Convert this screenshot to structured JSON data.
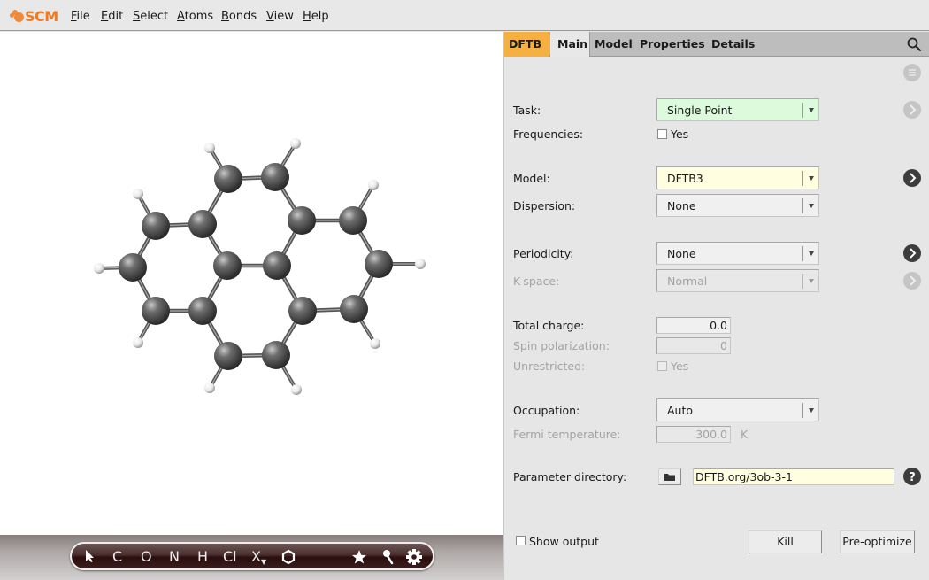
{
  "app": {
    "logo_text": "SCM",
    "brand_color": "#ee7a24"
  },
  "menubar": {
    "items": [
      {
        "label": "File",
        "accel": "F"
      },
      {
        "label": "Edit",
        "accel": "E"
      },
      {
        "label": "Select",
        "accel": "S"
      },
      {
        "label": "Atoms",
        "accel": "A"
      },
      {
        "label": "Bonds",
        "accel": "B"
      },
      {
        "label": "View",
        "accel": "V"
      },
      {
        "label": "Help",
        "accel": "H"
      }
    ]
  },
  "viewer": {
    "molecule": "pyrene",
    "atoms": [
      {
        "el": "C"
      },
      {
        "el": "C"
      },
      {
        "el": "C"
      },
      {
        "el": "C"
      },
      {
        "el": "C"
      },
      {
        "el": "C"
      },
      {
        "el": "C"
      },
      {
        "el": "C"
      },
      {
        "el": "C"
      },
      {
        "el": "C"
      },
      {
        "el": "C"
      },
      {
        "el": "C"
      },
      {
        "el": "C"
      },
      {
        "el": "C"
      },
      {
        "el": "C"
      },
      {
        "el": "C"
      },
      {
        "el": "H"
      },
      {
        "el": "H"
      },
      {
        "el": "H"
      },
      {
        "el": "H"
      },
      {
        "el": "H"
      },
      {
        "el": "H"
      },
      {
        "el": "H"
      },
      {
        "el": "H"
      },
      {
        "el": "H"
      },
      {
        "el": "H"
      }
    ],
    "toolbar": {
      "tools": [
        {
          "name": "select-tool",
          "icon": "cursor-arrow-icon"
        },
        {
          "name": "carbon",
          "label": "C"
        },
        {
          "name": "oxygen",
          "label": "O"
        },
        {
          "name": "nitrogen",
          "label": "N"
        },
        {
          "name": "hydrogen",
          "label": "H"
        },
        {
          "name": "chlorine",
          "label": "Cl"
        },
        {
          "name": "other-element",
          "label": "X"
        },
        {
          "name": "ring",
          "icon": "hexagon-icon"
        },
        {
          "name": "favorites",
          "icon": "star-icon"
        },
        {
          "name": "pin",
          "icon": "pin-icon"
        },
        {
          "name": "settings",
          "icon": "gear-icon"
        }
      ]
    }
  },
  "panel": {
    "breadcrumb": "DFTB",
    "breadcrumb_color": "#f6b042",
    "tabs": [
      "Main",
      "Model",
      "Properties",
      "Details"
    ],
    "active_tab": "Main",
    "fields": {
      "task": {
        "label": "Task:",
        "value": "Single Point",
        "bg": "#dcfadc"
      },
      "frequencies": {
        "label": "Frequencies:",
        "option": "Yes",
        "checked": false
      },
      "model": {
        "label": "Model:",
        "value": "DFTB3",
        "bg": "#fffee0"
      },
      "dispersion": {
        "label": "Dispersion:",
        "value": "None"
      },
      "periodicity": {
        "label": "Periodicity:",
        "value": "None"
      },
      "kspace": {
        "label": "K-space:",
        "value": "Normal",
        "disabled": true
      },
      "total_charge": {
        "label": "Total charge:",
        "value": "0.0"
      },
      "spin_polarization": {
        "label": "Spin polarization:",
        "value": "0",
        "disabled": true
      },
      "unrestricted": {
        "label": "Unrestricted:",
        "option": "Yes",
        "checked": false,
        "disabled": true
      },
      "occupation": {
        "label": "Occupation:",
        "value": "Auto"
      },
      "fermi_temperature": {
        "label": "Fermi temperature:",
        "value": "300.0",
        "unit": "K",
        "disabled": true
      },
      "parameter_directory": {
        "label": "Parameter directory:",
        "value": "DFTB.org/3ob-3-1"
      }
    },
    "footer": {
      "show_output": {
        "label": "Show output",
        "checked": false
      },
      "kill_label": "Kill",
      "preoptimize_label": "Pre-optimize"
    }
  }
}
